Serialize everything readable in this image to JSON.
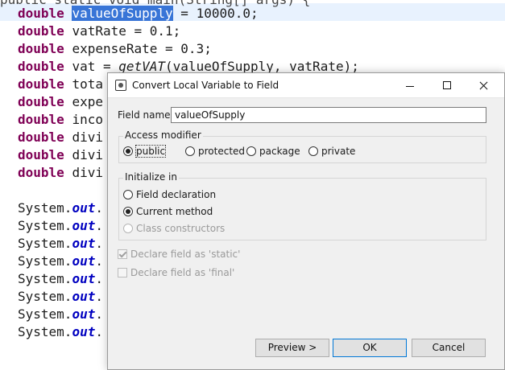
{
  "editor": {
    "top_line": "public static void main(String[] args) {",
    "lines": [
      {
        "kw": "double",
        "pre": "",
        "sel": "valueOfSupply",
        "post": " = 10000.0;"
      },
      {
        "kw": "double",
        "pre": "vatRate = 0.1;",
        "sel": "",
        "post": ""
      },
      {
        "kw": "double",
        "pre": "expenseRate = 0.3;",
        "sel": "",
        "post": ""
      },
      {
        "kw": "double",
        "pre": "vat = ",
        "ital": "getVAT",
        "post": "(valueOfSupply, vatRate);"
      },
      {
        "kw": "double",
        "pre": "tota"
      },
      {
        "kw": "double",
        "pre": "expe"
      },
      {
        "kw": "double",
        "pre": "inco"
      },
      {
        "kw": "double",
        "pre": "divi"
      },
      {
        "kw": "double",
        "pre": "divi"
      },
      {
        "kw": "double",
        "pre": "divi"
      }
    ],
    "sysout": {
      "prefix": "System.",
      "field": "out",
      "suffix": "."
    }
  },
  "dialog": {
    "title": "Convert Local Variable to Field",
    "field_name_label": "Field name:",
    "field_name_value": "valueOfSupply",
    "access_modifier": {
      "title": "Access modifier",
      "options": [
        "public",
        "protected",
        "package",
        "private"
      ],
      "selected": "public"
    },
    "initialize_in": {
      "title": "Initialize in",
      "options": [
        "Field declaration",
        "Current method",
        "Class constructors"
      ],
      "selected": "Current method",
      "disabled": [
        "Class constructors"
      ]
    },
    "declare_static": {
      "label": "Declare field as 'static'",
      "checked": true,
      "enabled": false
    },
    "declare_final": {
      "label": "Declare field as 'final'",
      "checked": false,
      "enabled": false
    },
    "buttons": {
      "preview": "Preview >",
      "ok": "OK",
      "cancel": "Cancel"
    }
  }
}
